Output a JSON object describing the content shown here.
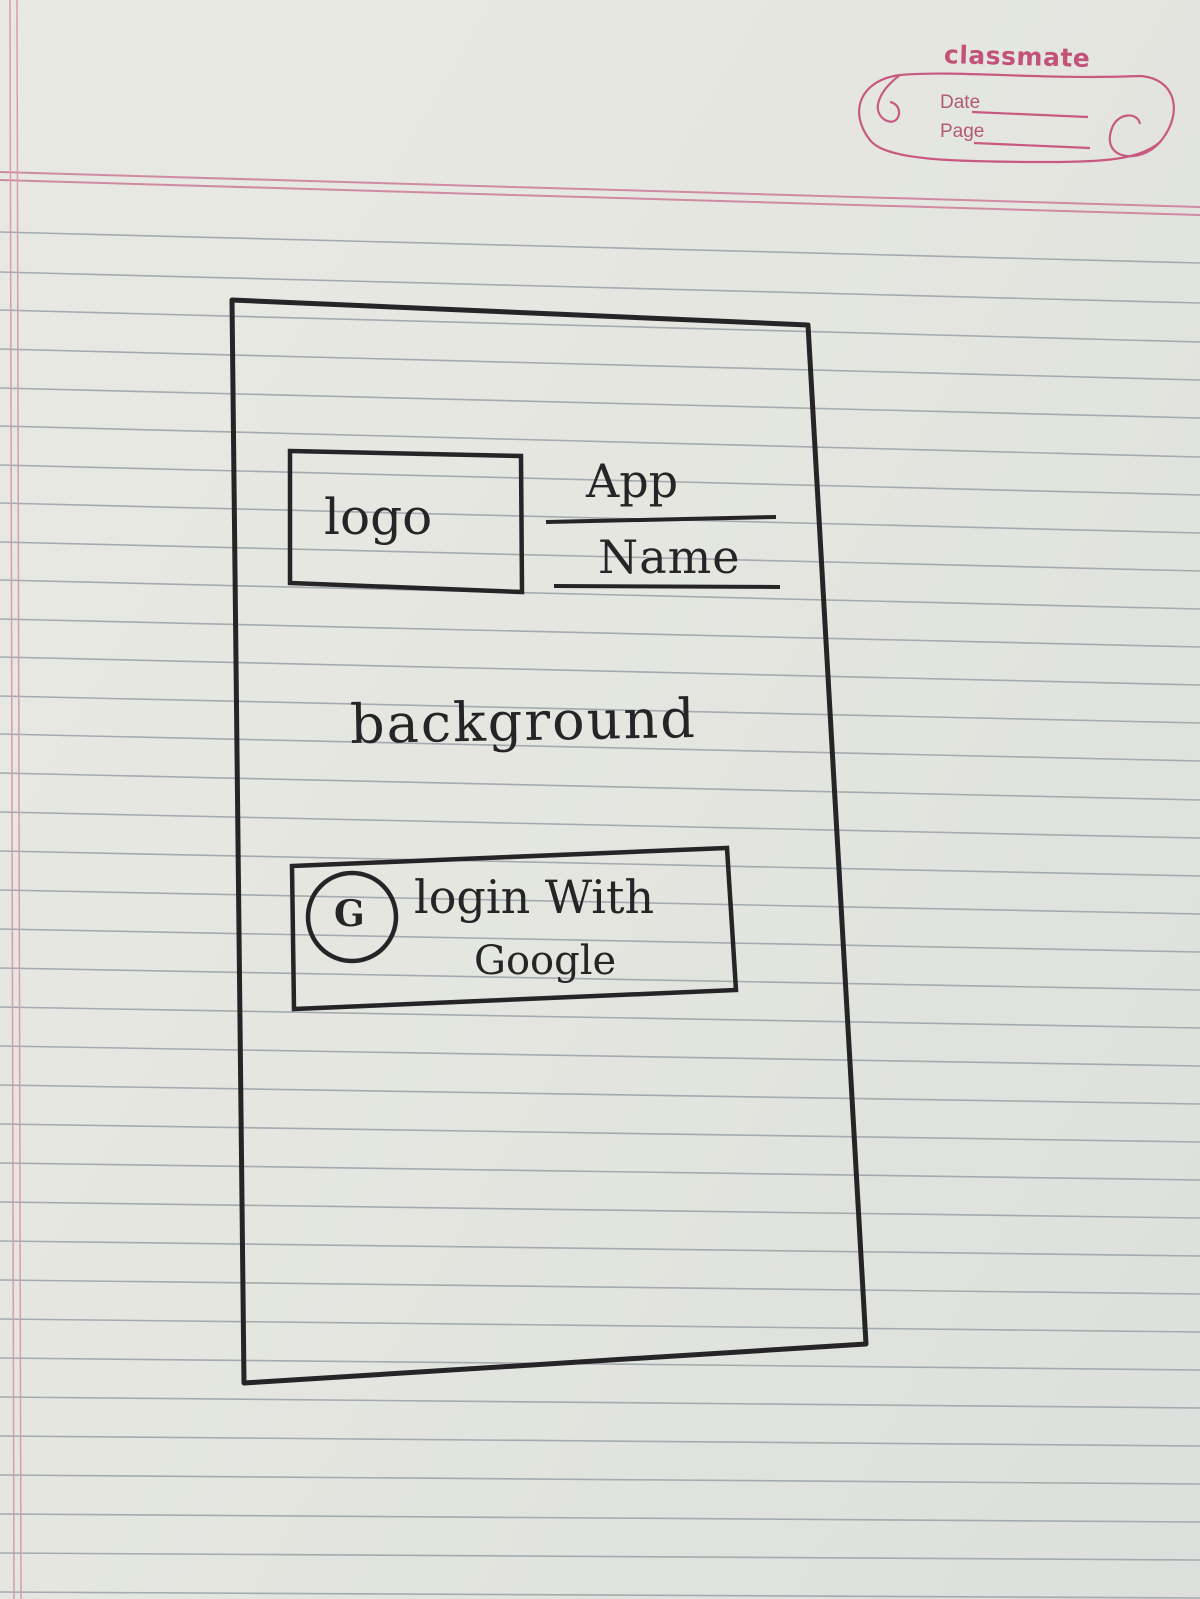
{
  "notebook": {
    "brand": "classmate",
    "date_label": "Date",
    "page_label": "Page",
    "colors": {
      "margin_line": "#d08aa2",
      "ruled_line": "#9fa8ad",
      "ink": "#262427",
      "brand": "#c2527a"
    }
  },
  "wireframe": {
    "logo_placeholder": "logo",
    "app_name": {
      "line1": "App",
      "line2": "Name"
    },
    "background_label": "background",
    "login_button": {
      "icon": "google-g-icon",
      "icon_letter": "G",
      "line1": "login With",
      "line2": "Google"
    }
  }
}
